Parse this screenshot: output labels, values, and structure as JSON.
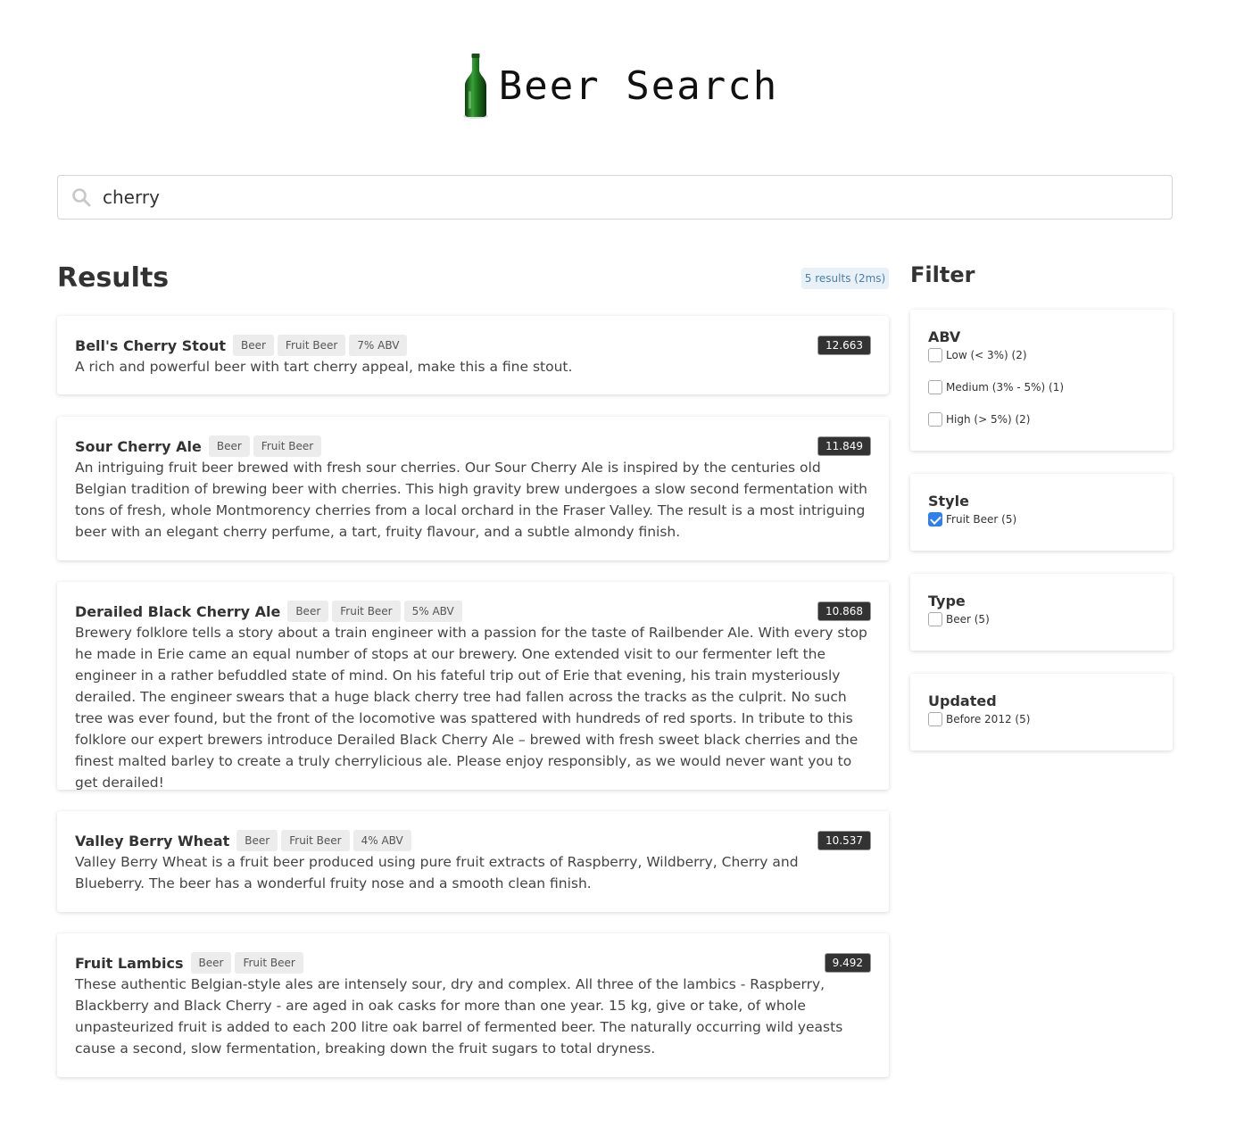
{
  "header": {
    "title": "Beer Search",
    "logo_icon": "beer-bottle-icon"
  },
  "search": {
    "value": "cherry",
    "icon": "search-icon"
  },
  "results": {
    "title": "Results",
    "count_label": "5 results (2ms)",
    "items": [
      {
        "name": "Bell's Cherry Stout",
        "tags": [
          "Beer",
          "Fruit Beer",
          "7% ABV"
        ],
        "score": "12.663",
        "description": "A rich and powerful beer with tart cherry appeal, make this a fine stout."
      },
      {
        "name": "Sour Cherry Ale",
        "tags": [
          "Beer",
          "Fruit Beer"
        ],
        "score": "11.849",
        "description": "An intriguing fruit beer brewed with fresh sour cherries. Our Sour Cherry Ale is inspired by the centuries old Belgian tradition of brewing beer with cherries. This high gravity brew undergoes a slow second fermentation with tons of fresh, whole Montmorency cherries from a local orchard in the Fraser Valley. The result is a most intriguing beer with an elegant cherry perfume, a tart, fruity flavour, and a subtle almondy finish."
      },
      {
        "name": "Derailed Black Cherry Ale",
        "tags": [
          "Beer",
          "Fruit Beer",
          "5% ABV"
        ],
        "score": "10.868",
        "description": "Brewery folklore tells a story about a train engineer with a passion for the taste of Railbender Ale. With every stop he made in Erie came an equal number of stops at our brewery. One extended visit to our fermenter left the engineer in a rather befuddled state of mind. On his fateful trip out of Erie that evening, his train mysteriously derailed. The engineer swears that a huge black cherry tree had fallen across the tracks as the culprit. No such tree was ever found, but the front of the locomotive was spattered with hundreds of red sports. In tribute to this folklore our expert brewers introduce Derailed Black Cherry Ale – brewed with fresh sweet black cherries and the finest malted barley to create a truly cherrylicious ale. Please enjoy responsibly, as we would never want you to get derailed!"
      },
      {
        "name": "Valley Berry Wheat",
        "tags": [
          "Beer",
          "Fruit Beer",
          "4% ABV"
        ],
        "score": "10.537",
        "description": "Valley Berry Wheat is a fruit beer produced using pure fruit extracts of Raspberry, Wildberry, Cherry and Blueberry. The beer has a wonderful fruity nose and a smooth clean finish."
      },
      {
        "name": "Fruit Lambics",
        "tags": [
          "Beer",
          "Fruit Beer"
        ],
        "score": "9.492",
        "description": "These authentic Belgian-style ales are intensely sour, dry and complex. All three of the lambics - Raspberry, Blackberry and Black Cherry - are aged in oak casks for more than one year. 15 kg, give or take, of whole unpasteurized fruit is added to each 200 litre oak barrel of fermented beer. The naturally occurring wild yeasts cause a second, slow fermentation, breaking down the fruit sugars to total dryness."
      }
    ]
  },
  "filter": {
    "title": "Filter",
    "groups": [
      {
        "title": "ABV",
        "options": [
          {
            "label": "Low (< 3%) (2)",
            "checked": false
          },
          {
            "label": "Medium (3% - 5%) (1)",
            "checked": false
          },
          {
            "label": "High (> 5%) (2)",
            "checked": false
          }
        ]
      },
      {
        "title": "Style",
        "options": [
          {
            "label": "Fruit Beer (5)",
            "checked": true
          }
        ]
      },
      {
        "title": "Type",
        "options": [
          {
            "label": "Beer (5)",
            "checked": false
          }
        ]
      },
      {
        "title": "Updated",
        "options": [
          {
            "label": "Before 2012 (5)",
            "checked": false
          }
        ]
      }
    ]
  },
  "colors": {
    "accent": "#2f80ed",
    "score_bg": "#333333",
    "count_bg": "#e8f1f8",
    "count_text": "#4a7fa8"
  }
}
